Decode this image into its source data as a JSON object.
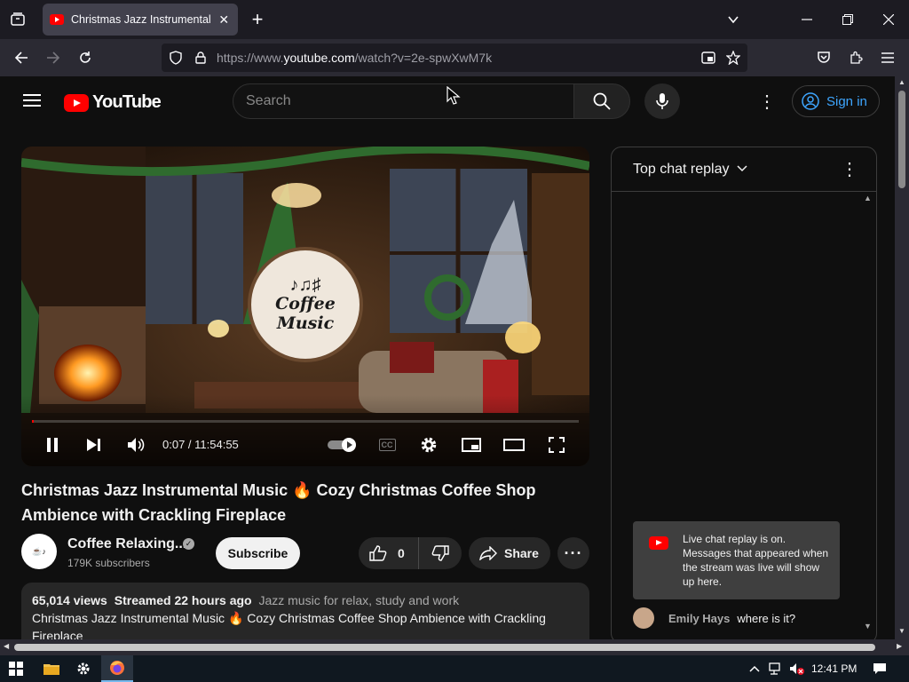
{
  "browser": {
    "tab_title": "Christmas Jazz Instrumental Mu",
    "url_prefix": "https://www.",
    "url_domain": "youtube.com",
    "url_rest": "/watch?v=2e-spwXwM7k"
  },
  "youtube": {
    "logo_text": "YouTube",
    "search_placeholder": "Search",
    "sign_in_label": "Sign in"
  },
  "player": {
    "time_display": "0:07 / 11:54:55",
    "cc_label": "CC",
    "logo_line1": "Coffee",
    "logo_line2": "Music",
    "progress": 0.0002
  },
  "video": {
    "title": "Christmas Jazz Instrumental Music 🔥 Cozy Christmas Coffee Shop Ambience with Crackling Fireplace",
    "channel_name": "Coffee Relaxing...",
    "subscribers": "179K subscribers",
    "subscribe_label": "Subscribe",
    "likes": "0",
    "share_label": "Share",
    "views": "65,014 views",
    "streamed": "Streamed 22 hours ago",
    "tagline": "Jazz music for relax, study and work",
    "description": "Christmas Jazz Instrumental Music 🔥 Cozy Christmas Coffee Shop Ambience with Crackling Fireplace"
  },
  "chat": {
    "title": "Top chat replay",
    "notice": "Live chat replay is on. Messages that appeared when the stream was live will show up here.",
    "messages": [
      {
        "author": "Emily Hays",
        "text": "where is it?"
      }
    ]
  },
  "taskbar": {
    "time": "12:41 PM"
  },
  "colors": {
    "accent_red": "#ff0000",
    "link_blue": "#3ea6ff",
    "background": "#0f0f0f"
  }
}
